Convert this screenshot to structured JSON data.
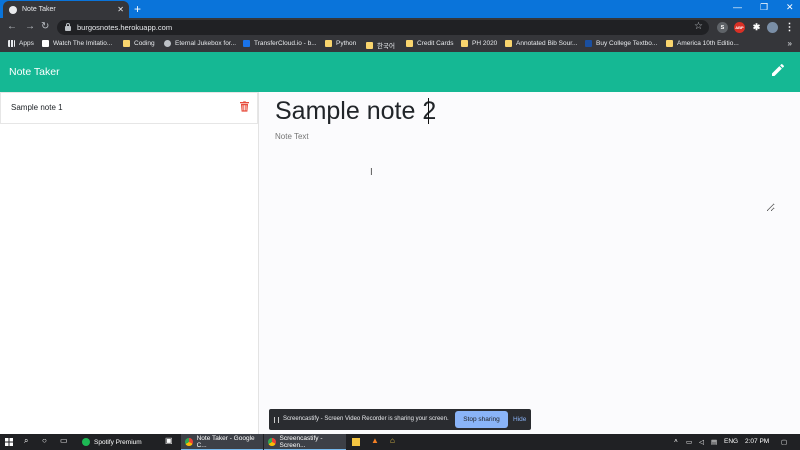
{
  "browser": {
    "tab_title": "Note Taker",
    "url": "burgosnotes.herokuapp.com",
    "new_tab_label": "+",
    "window_controls": [
      "—",
      "❐",
      "✕"
    ],
    "extension_labels": [
      "S",
      "ABP"
    ],
    "bookmarks": [
      {
        "label": "Apps",
        "icon": "apps-grid-icon"
      },
      {
        "label": "Watch The Imitatio...",
        "icon": "bookmark-site-icon"
      },
      {
        "label": "Coding",
        "icon": "folder-icon"
      },
      {
        "label": "Eternal Jukebox for...",
        "icon": "globe-icon"
      },
      {
        "label": "TransferCloud.io - b...",
        "icon": "bookmark-site-icon"
      },
      {
        "label": "Python",
        "icon": "folder-icon"
      },
      {
        "label": "한국어",
        "icon": "folder-icon"
      },
      {
        "label": "Credit Cards",
        "icon": "folder-icon"
      },
      {
        "label": "PH 2020",
        "icon": "folder-icon"
      },
      {
        "label": "Annotated Bib Sour...",
        "icon": "folder-icon"
      },
      {
        "label": "Buy College Textbo...",
        "icon": "bookmark-site-icon"
      },
      {
        "label": "America 10th Editio...",
        "icon": "folder-icon"
      }
    ],
    "bookmarks_more": "»"
  },
  "app": {
    "brand": "Note Taker",
    "notes": [
      {
        "title": "Sample note 1"
      }
    ],
    "editor": {
      "title_value": "Sample note 2",
      "text_placeholder": "Note Text"
    },
    "accent_color": "#15b894",
    "delete_color": "#e74c3c"
  },
  "share_bar": {
    "message": "Screencastify - Screen Video Recorder is sharing your screen.",
    "stop_label": "Stop sharing",
    "hide_label": "Hide"
  },
  "taskbar": {
    "tasks": [
      {
        "label": "Spotify Premium",
        "icon": "spotify-icon",
        "color": "#1db954"
      },
      {
        "label": "Note Taker - Google C...",
        "icon": "chrome-icon",
        "color": "#4285f4"
      },
      {
        "label": "Screencastify - Screen...",
        "icon": "chrome-icon",
        "color": "#4285f4"
      }
    ],
    "language": "ENG",
    "time": "2:07 PM"
  }
}
